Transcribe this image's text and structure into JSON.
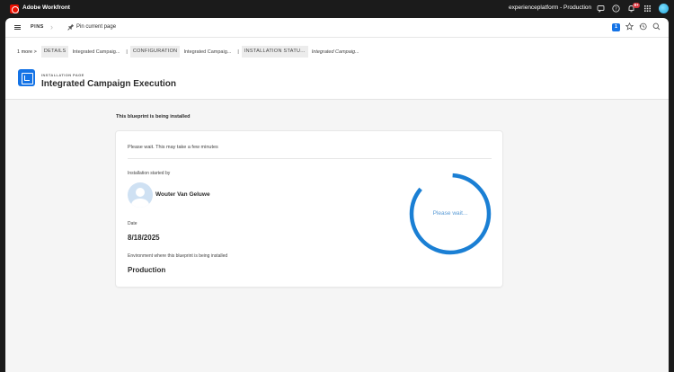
{
  "topbar": {
    "app_name": "Adobe Workfront",
    "environment": "experienceplatform - Production",
    "notification_count": "9+",
    "icons": [
      "feedback-icon",
      "help-icon",
      "bell-icon",
      "apps-grid-icon",
      "user-avatar"
    ]
  },
  "navbar": {
    "pins_label": "PINS",
    "pin_current_label": "Pin current page",
    "badge_count": "1"
  },
  "breadcrumb": {
    "more": "1 more  >",
    "items": [
      {
        "label": "DETAILS",
        "value": "Integrated Campaig..."
      },
      {
        "label": "CONFIGURATION",
        "value": "Integrated Campaig..."
      },
      {
        "label": "INSTALLATION STATU...",
        "value": "Integrated Campaig..."
      }
    ],
    "separator": "|"
  },
  "page": {
    "kicker": "INSTALLATION PAGE",
    "title": "Integrated Campaign Execution"
  },
  "content": {
    "section_title": "This blueprint is being installed",
    "wait_message": "Please wait. This may take a few minutes",
    "started_by_label": "Installation started by",
    "user_name": "Wouter Van Geluwe",
    "date_label": "Date",
    "date_value": "8/18/2025",
    "environment_label": "Environment where this blueprint is being installed",
    "environment_value": "Production",
    "spinner_label": "Please wait..."
  },
  "colors": {
    "accent": "#1473e6",
    "spinner": "#1a7fd4",
    "brand_red": "#eb1000"
  }
}
